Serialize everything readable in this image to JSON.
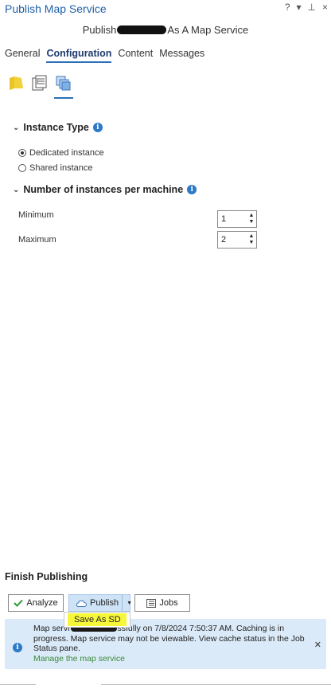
{
  "pane": {
    "title": "Publish Map Service",
    "controls": [
      "?",
      "▾",
      "⊥",
      "×"
    ]
  },
  "heading": {
    "before": "Publish",
    "after": "As A Map Service"
  },
  "tabs": [
    {
      "label": "General",
      "active": false
    },
    {
      "label": "Configuration",
      "active": true
    },
    {
      "label": "Content",
      "active": false
    },
    {
      "label": "Messages",
      "active": false
    }
  ],
  "subtabs": [
    {
      "icon": "map-folder-icon",
      "active": false
    },
    {
      "icon": "properties-icon",
      "active": false
    },
    {
      "icon": "pages-icon",
      "active": true
    }
  ],
  "instance_type": {
    "title": "Instance Type",
    "options": [
      {
        "label": "Dedicated instance",
        "selected": true
      },
      {
        "label": "Shared instance",
        "selected": false
      }
    ]
  },
  "instances_per_machine": {
    "title": "Number of instances per machine",
    "minimum_label": "Minimum",
    "minimum_value": "1",
    "maximum_label": "Maximum",
    "maximum_value": "2"
  },
  "finish": {
    "title": "Finish Publishing",
    "analyze_label": "Analyze",
    "publish_label": "Publish",
    "jobs_label": "Jobs",
    "dropdown_item": "Save As SD"
  },
  "message": {
    "line_start": "Map servi",
    "line_rest": "ssfully on 7/8/2024 7:50:37 AM. Caching is in progress. Map service may not be viewable. View cache status in the Job Status pane.",
    "link": "Manage the map service"
  },
  "colors": {
    "accent": "#2b6fb8",
    "title_blue": "#1f5fa8",
    "message_bg": "#dbeaf8",
    "highlight": "#f7f73a",
    "link_green": "#3a8a3a"
  }
}
